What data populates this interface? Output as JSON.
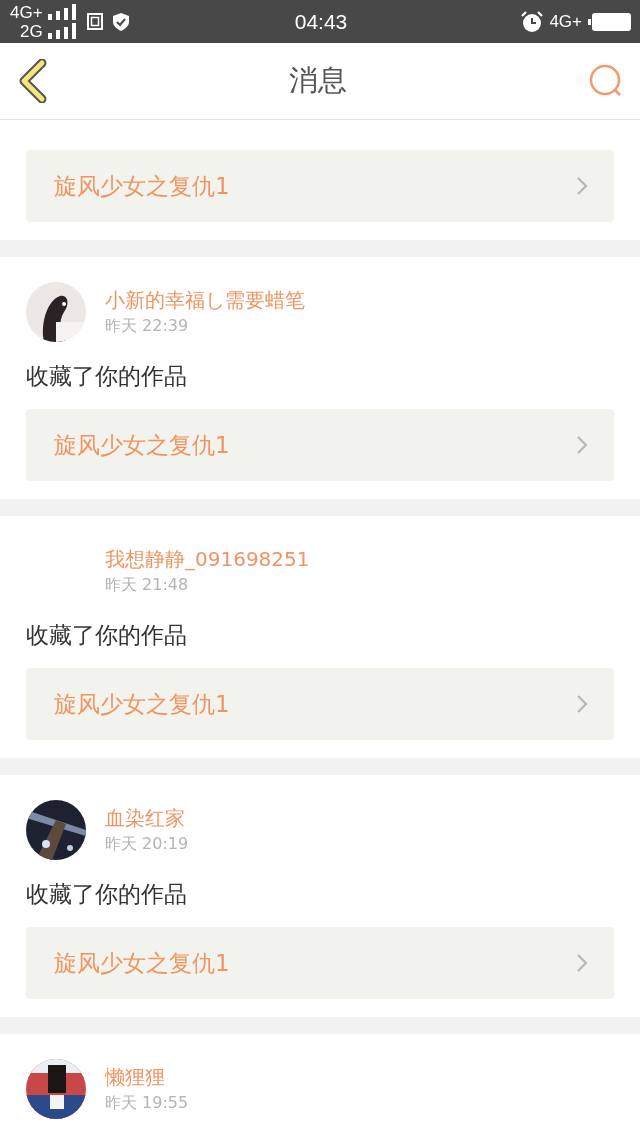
{
  "status_bar": {
    "network_1": "4G+",
    "network_2": "2G",
    "time": "04:43",
    "network_3": "4G+"
  },
  "header": {
    "title": "消息"
  },
  "messages": [
    {
      "work": "旋风少女之复仇1"
    },
    {
      "user": "小新的幸福し需要蜡笔",
      "time": "昨天 22:39",
      "action": "收藏了你的作品",
      "work": "旋风少女之复仇1"
    },
    {
      "user": "我想静静_091698251",
      "time": "昨天 21:48",
      "action": "收藏了你的作品",
      "work": "旋风少女之复仇1"
    },
    {
      "user": "血染红家",
      "time": "昨天 20:19",
      "action": "收藏了你的作品",
      "work": "旋风少女之复仇1"
    },
    {
      "user": "懒狸狸",
      "time": "昨天 19:55"
    }
  ]
}
